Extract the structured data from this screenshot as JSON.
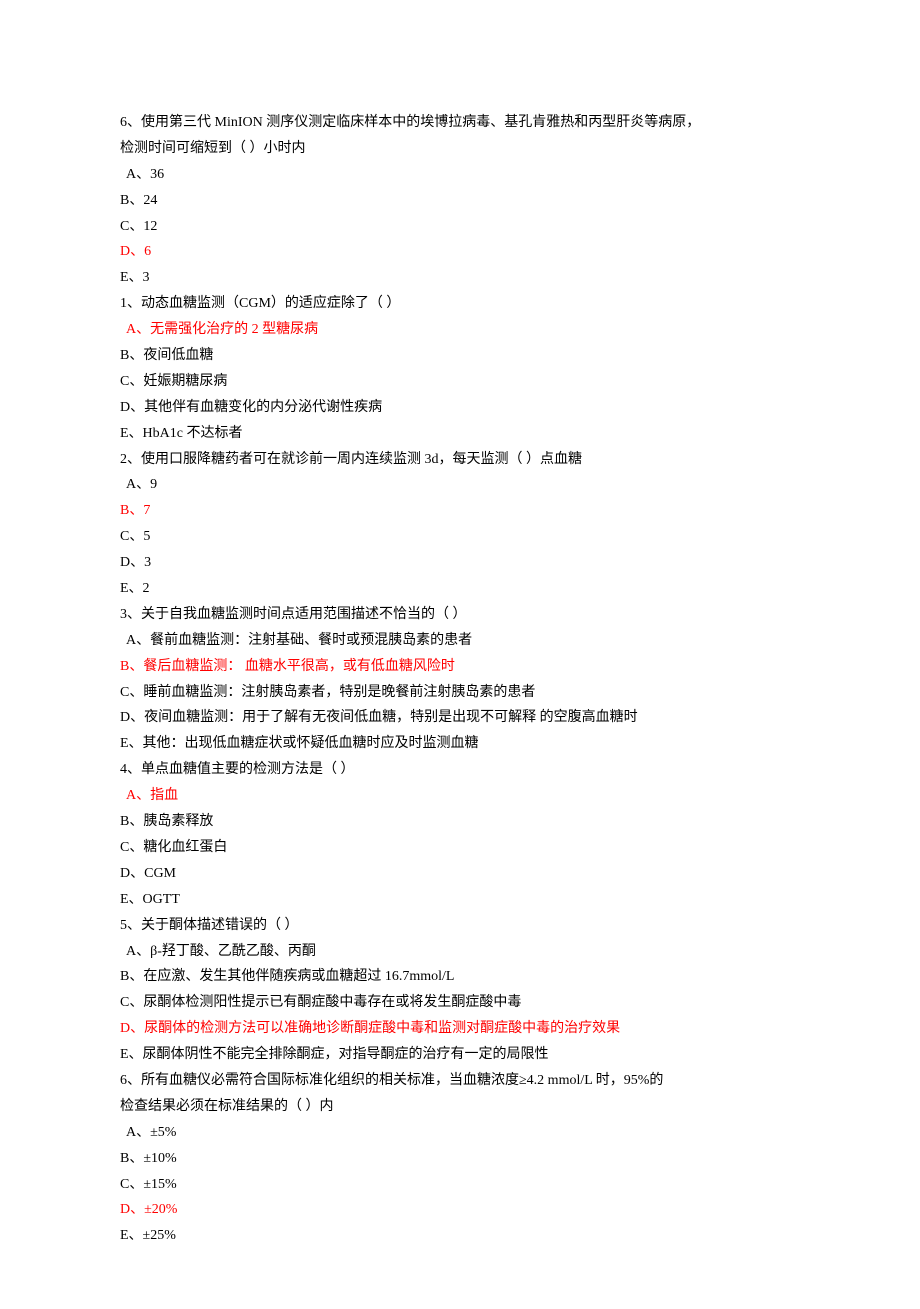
{
  "lines": [
    {
      "text": "6、使用第三代 MinION 测序仪测定临床样本中的埃博拉病毒、基孔肯雅热和丙型肝炎等病原，",
      "answer": false,
      "indent": false
    },
    {
      "text": "检测时间可缩短到（ ）小时内",
      "answer": false,
      "indent": false
    },
    {
      "text": " A、36",
      "answer": false,
      "indent": true
    },
    {
      "text": "B、24",
      "answer": false,
      "indent": false
    },
    {
      "text": "C、12",
      "answer": false,
      "indent": false
    },
    {
      "text": "D、6",
      "answer": true,
      "indent": false
    },
    {
      "text": "E、3",
      "answer": false,
      "indent": false
    },
    {
      "text": "1、动态血糖监测（CGM）的适应症除了（ ）",
      "answer": false,
      "indent": false
    },
    {
      "text": " A、无需强化治疗的 2 型糖尿病",
      "answer": true,
      "indent": true
    },
    {
      "text": "B、夜间低血糖",
      "answer": false,
      "indent": false
    },
    {
      "text": "C、妊娠期糖尿病",
      "answer": false,
      "indent": false
    },
    {
      "text": "D、其他伴有血糖变化的内分泌代谢性疾病",
      "answer": false,
      "indent": false
    },
    {
      "text": "E、HbA1c 不达标者",
      "answer": false,
      "indent": false
    },
    {
      "text": "2、使用口服降糖药者可在就诊前一周内连续监测 3d，每天监测（ ）点血糖",
      "answer": false,
      "indent": false
    },
    {
      "text": " A、9",
      "answer": false,
      "indent": true
    },
    {
      "text": "B、7",
      "answer": true,
      "indent": false
    },
    {
      "text": "C、5",
      "answer": false,
      "indent": false
    },
    {
      "text": "D、3",
      "answer": false,
      "indent": false
    },
    {
      "text": "E、2",
      "answer": false,
      "indent": false
    },
    {
      "text": "3、关于自我血糖监测时间点适用范围描述不恰当的（ ）",
      "answer": false,
      "indent": false
    },
    {
      "text": " A、餐前血糖监测：注射基础、餐时或预混胰岛素的患者",
      "answer": false,
      "indent": true
    },
    {
      "text": "B、餐后血糖监测： 血糖水平很高，或有低血糖风险时",
      "answer": true,
      "indent": false
    },
    {
      "text": "C、睡前血糖监测：注射胰岛素者，特别是晚餐前注射胰岛素的患者",
      "answer": false,
      "indent": false
    },
    {
      "text": "D、夜间血糖监测：用于了解有无夜间低血糖，特别是出现不可解释 的空腹高血糖时",
      "answer": false,
      "indent": false
    },
    {
      "text": "E、其他：出现低血糖症状或怀疑低血糖时应及时监测血糖",
      "answer": false,
      "indent": false
    },
    {
      "text": "4、单点血糖值主要的检测方法是（ ）",
      "answer": false,
      "indent": false
    },
    {
      "text": " A、指血",
      "answer": true,
      "indent": true
    },
    {
      "text": "B、胰岛素释放",
      "answer": false,
      "indent": false
    },
    {
      "text": "C、糖化血红蛋白",
      "answer": false,
      "indent": false
    },
    {
      "text": "D、CGM",
      "answer": false,
      "indent": false
    },
    {
      "text": "E、OGTT",
      "answer": false,
      "indent": false
    },
    {
      "text": "5、关于酮体描述错误的（ ）",
      "answer": false,
      "indent": false
    },
    {
      "text": " A、β-羟丁酸、乙酰乙酸、丙酮",
      "answer": false,
      "indent": true
    },
    {
      "text": "B、在应激、发生其他伴随疾病或血糖超过 16.7mmol/L",
      "answer": false,
      "indent": false
    },
    {
      "text": "C、尿酮体检测阳性提示已有酮症酸中毒存在或将发生酮症酸中毒",
      "answer": false,
      "indent": false
    },
    {
      "text": "D、尿酮体的检测方法可以准确地诊断酮症酸中毒和监测对酮症酸中毒的治疗效果",
      "answer": true,
      "indent": false
    },
    {
      "text": "E、尿酮体阴性不能完全排除酮症，对指导酮症的治疗有一定的局限性",
      "answer": false,
      "indent": false
    },
    {
      "text": "6、所有血糖仪必需符合国际标准化组织的相关标准，当血糖浓度≥4.2 mmol/L 时，95%的",
      "answer": false,
      "indent": false
    },
    {
      "text": "检查结果必须在标准结果的（ ）内",
      "answer": false,
      "indent": false
    },
    {
      "text": " A、±5%",
      "answer": false,
      "indent": true
    },
    {
      "text": "B、±10%",
      "answer": false,
      "indent": false
    },
    {
      "text": "C、±15%",
      "answer": false,
      "indent": false
    },
    {
      "text": "D、±20%",
      "answer": true,
      "indent": false
    },
    {
      "text": "E、±25%",
      "answer": false,
      "indent": false
    }
  ]
}
